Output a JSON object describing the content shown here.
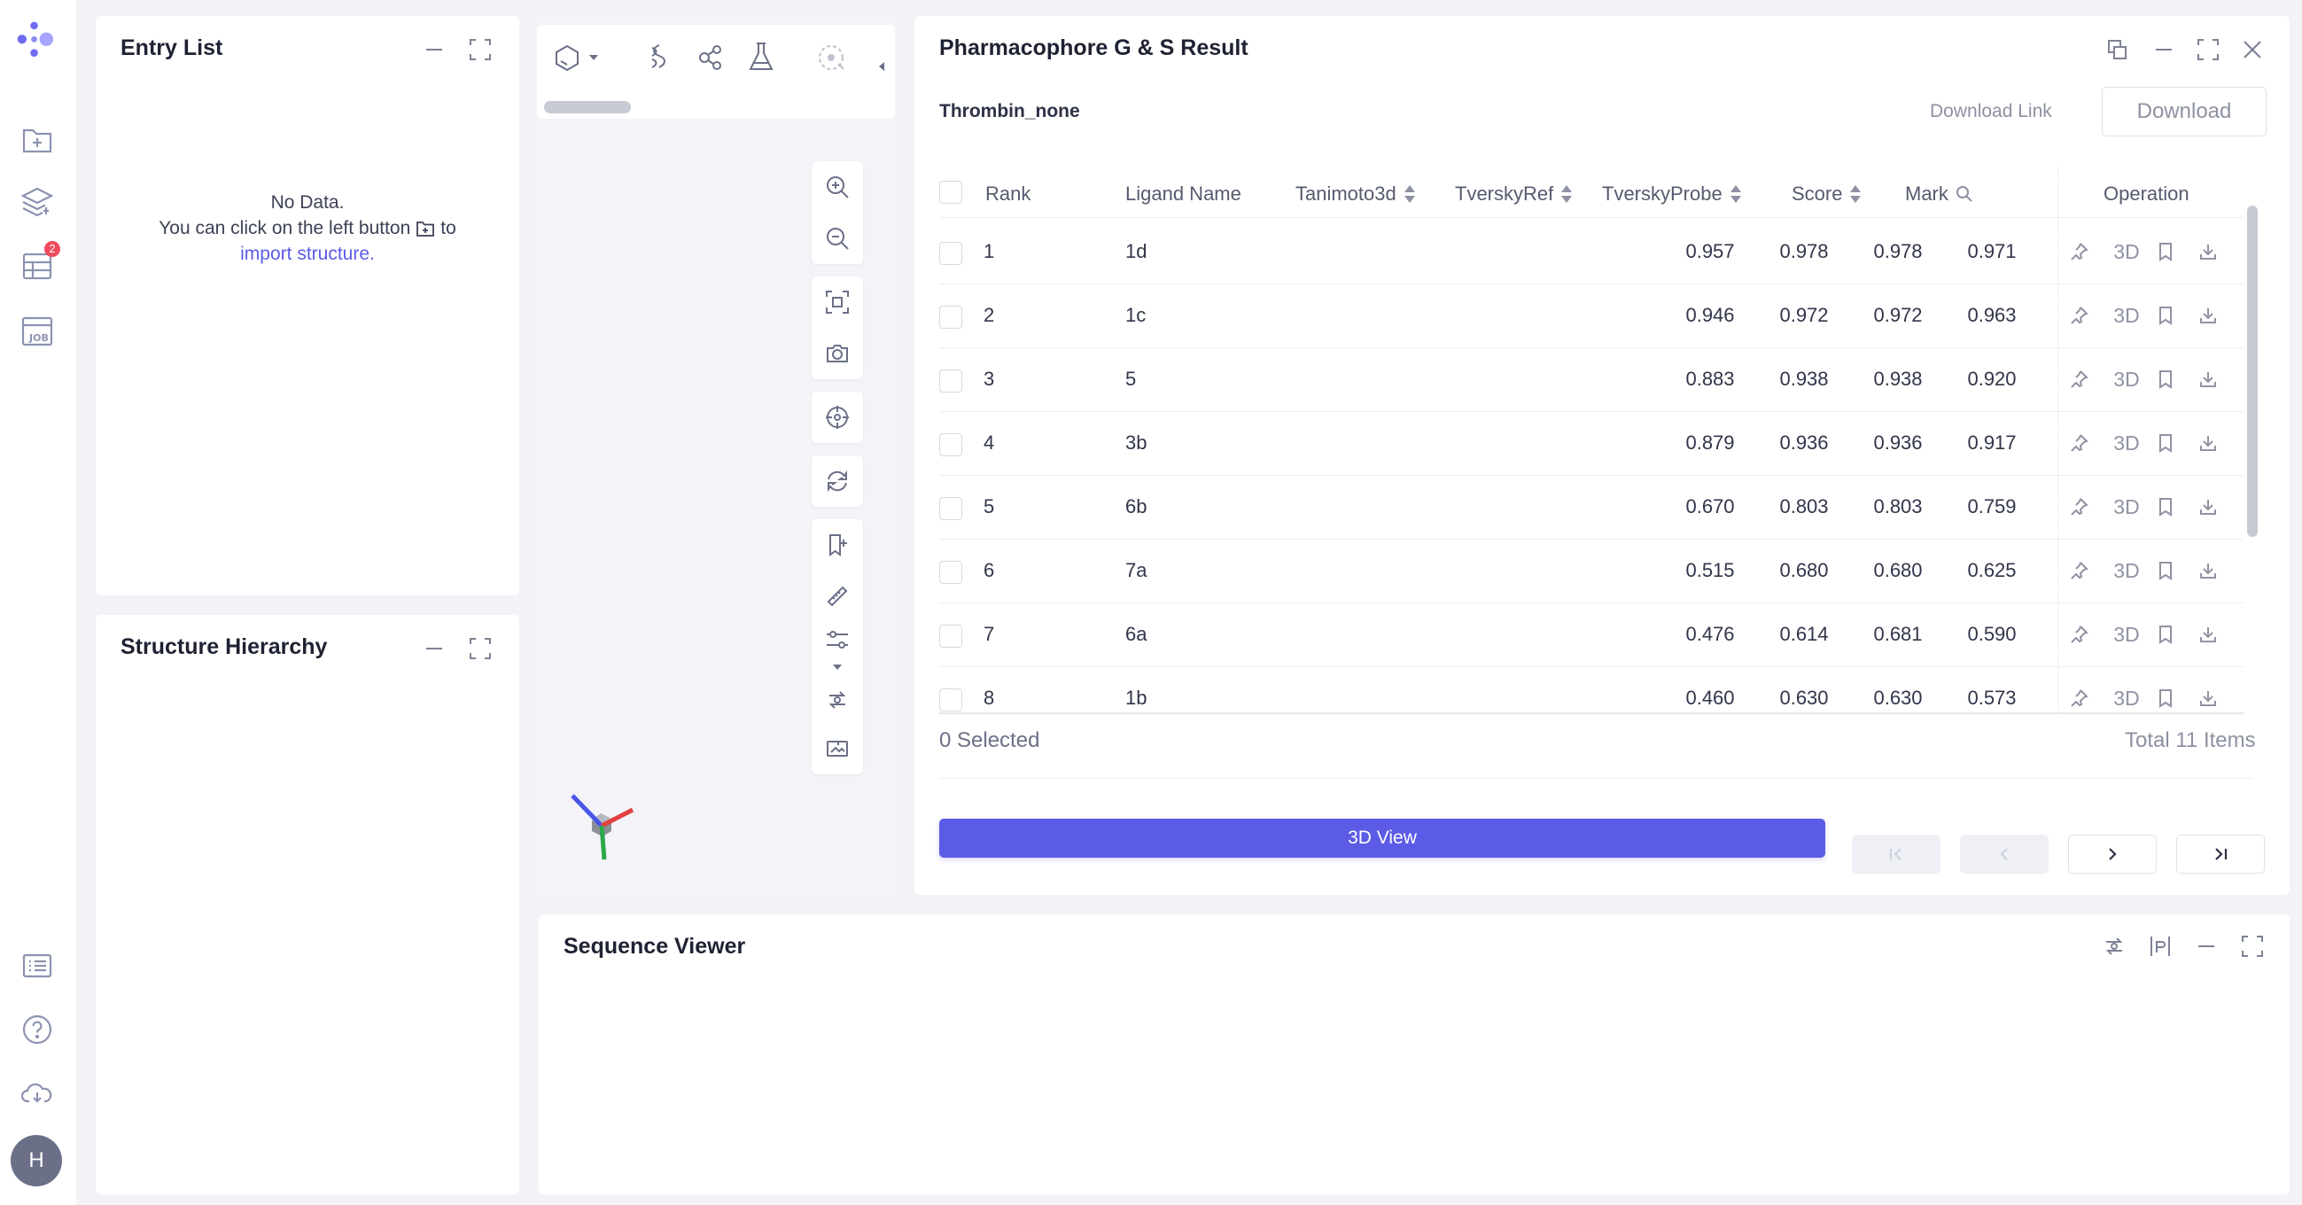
{
  "entry_list": {
    "title": "Entry List",
    "empty_title": "No Data.",
    "empty_hint_pre": "You can click on the left button",
    "empty_hint_post": "to",
    "import_link": "import structure."
  },
  "rail": {
    "job_badge": "2",
    "avatar_initial": "H"
  },
  "structure_hierarchy": {
    "title": "Structure Hierarchy"
  },
  "sequence_viewer": {
    "title": "Sequence Viewer"
  },
  "result": {
    "title": "Pharmacophore G & S Result",
    "target": "Thrombin_none",
    "download_link": "Download Link",
    "download_button": "Download",
    "columns": [
      "Rank",
      "Ligand Name",
      "Tanimoto3d",
      "TverskyRef",
      "TverskyProbe",
      "Score",
      "Mark",
      "Operation"
    ],
    "rows": [
      {
        "rank": "1",
        "ligand": "1d",
        "tanimoto": "0.957",
        "tref": "0.978",
        "tprobe": "0.978",
        "score": "0.971"
      },
      {
        "rank": "2",
        "ligand": "1c",
        "tanimoto": "0.946",
        "tref": "0.972",
        "tprobe": "0.972",
        "score": "0.963"
      },
      {
        "rank": "3",
        "ligand": "5",
        "tanimoto": "0.883",
        "tref": "0.938",
        "tprobe": "0.938",
        "score": "0.920"
      },
      {
        "rank": "4",
        "ligand": "3b",
        "tanimoto": "0.879",
        "tref": "0.936",
        "tprobe": "0.936",
        "score": "0.917"
      },
      {
        "rank": "5",
        "ligand": "6b",
        "tanimoto": "0.670",
        "tref": "0.803",
        "tprobe": "0.803",
        "score": "0.759"
      },
      {
        "rank": "6",
        "ligand": "7a",
        "tanimoto": "0.515",
        "tref": "0.680",
        "tprobe": "0.680",
        "score": "0.625"
      },
      {
        "rank": "7",
        "ligand": "6a",
        "tanimoto": "0.476",
        "tref": "0.614",
        "tprobe": "0.681",
        "score": "0.590"
      },
      {
        "rank": "8",
        "ligand": "1b",
        "tanimoto": "0.460",
        "tref": "0.630",
        "tprobe": "0.630",
        "score": "0.573"
      }
    ],
    "op_3d_label": "3D",
    "selected_text": "0 Selected",
    "total_text": "Total 11 Items",
    "view_3d_button": "3D View"
  },
  "colors": {
    "accent": "#5b5be6",
    "brand_dots": [
      "#6e6cf0",
      "#a6a4ff",
      "#8f8df7"
    ]
  }
}
